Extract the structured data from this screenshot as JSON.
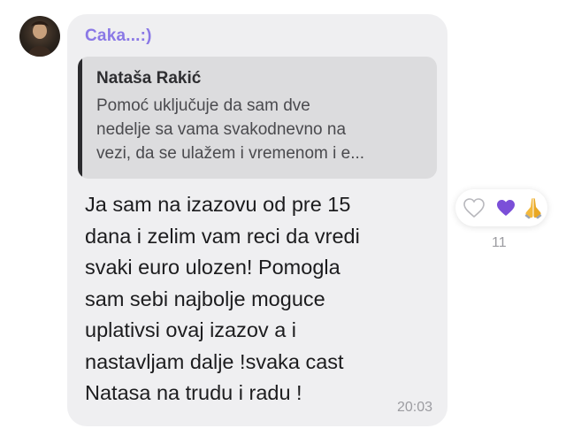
{
  "sender": {
    "name": "Caka...:)"
  },
  "quote": {
    "author": "Nataša Rakić",
    "lines": [
      "Pomoć uključuje da sam dve",
      "nedelje sa vama svakodnevno na",
      "vezi, da se ulažem i vremenom i e..."
    ]
  },
  "message": {
    "lines": [
      "Ja sam na izazovu od pre 15",
      "dana i zelim vam reci da vredi",
      "svaki euro ulozen! Pomogla",
      "sam sebi najbolje moguce",
      "uplativsi ovaj izazov a i",
      "nastavljam dalje !svaka cast",
      "Natasa na trudu i radu !"
    ],
    "time": "20:03"
  },
  "reactions": {
    "icons": [
      "heart-outline-icon",
      "purple-heart-icon",
      "praying-hands-icon"
    ],
    "count": "11"
  },
  "colors": {
    "sender": "#8a78e6",
    "bubble": "#efeff1",
    "quote_bg": "#dcdcde",
    "purple_heart": "#7b4fd8"
  }
}
